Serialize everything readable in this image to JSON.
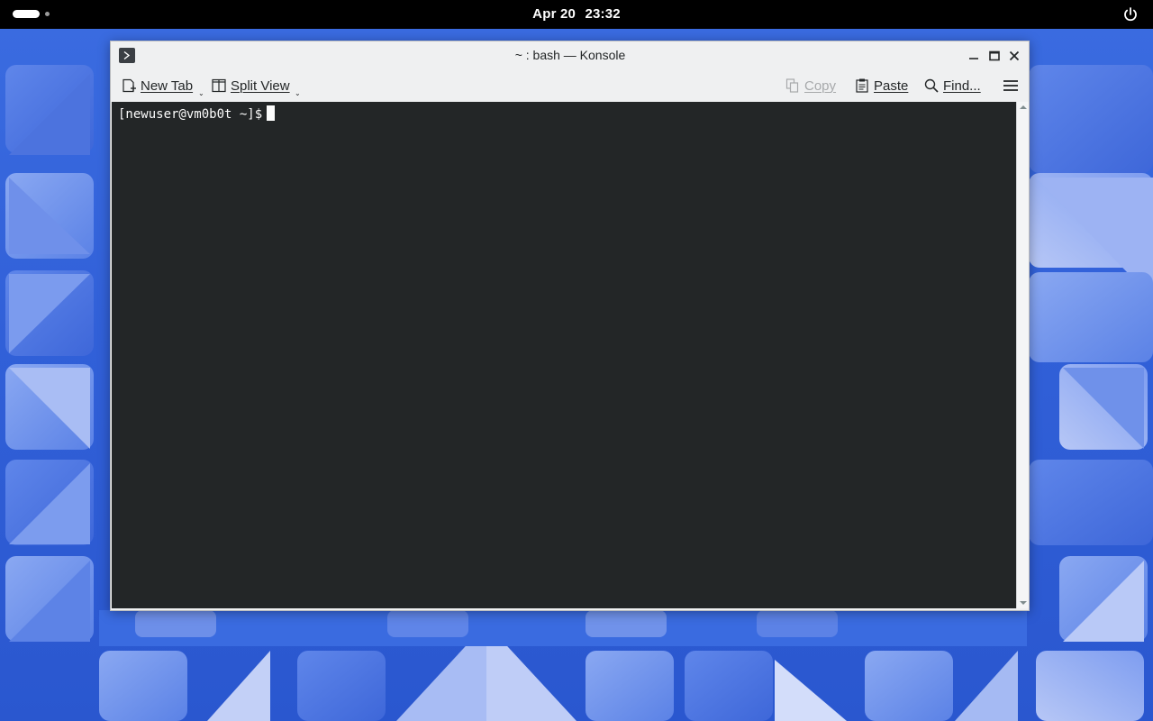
{
  "topbar": {
    "clock_date": "Apr 20",
    "clock_time": "23:32",
    "activities_icon": "activities-pill-icon",
    "power_icon": "power-icon"
  },
  "window": {
    "title": "~ : bash — Konsole",
    "app_icon": "terminal-icon",
    "controls": {
      "minimize_icon": "minimize-icon",
      "maximize_icon": "maximize-icon",
      "close_icon": "close-icon"
    }
  },
  "toolbar": {
    "new_tab_label": "New Tab",
    "split_view_label": "Split View",
    "copy_label": "Copy",
    "paste_label": "Paste",
    "find_label": "Find...",
    "menu_icon": "hamburger-menu-icon"
  },
  "terminal": {
    "prompt": "[newuser@vm0b0t ~]$"
  },
  "colors": {
    "terminal_background": "#232627",
    "terminal_foreground": "#fcfcfc",
    "window_chrome": "#eff0f1",
    "wallpaper_blue": "#3160d8",
    "topbar": "#000000"
  }
}
